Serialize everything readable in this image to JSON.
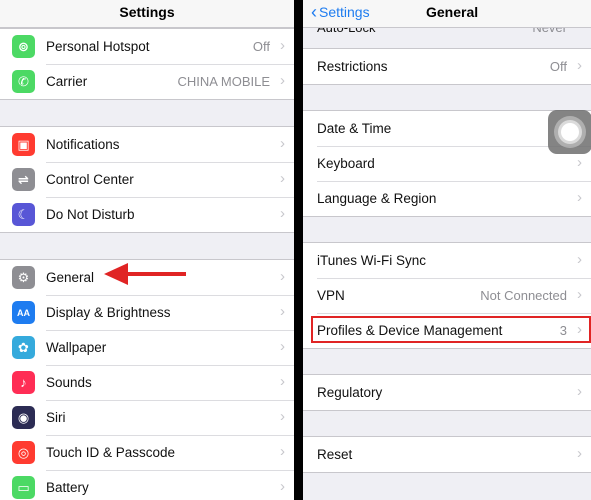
{
  "left": {
    "title": "Settings",
    "groups": [
      [
        {
          "label": "Personal Hotspot",
          "value": "Off",
          "icon": "hotspot-icon",
          "color": "#4cd964",
          "glyph": "⊚"
        },
        {
          "label": "Carrier",
          "value": "CHINA MOBILE",
          "icon": "phone-icon",
          "color": "#4cd964",
          "glyph": "✆"
        }
      ],
      [
        {
          "label": "Notifications",
          "value": "",
          "icon": "notifications-icon",
          "color": "#ff3b30",
          "glyph": "▣"
        },
        {
          "label": "Control Center",
          "value": "",
          "icon": "toggles-icon",
          "color": "#8e8e93",
          "glyph": "⇌"
        },
        {
          "label": "Do Not Disturb",
          "value": "",
          "icon": "moon-icon",
          "color": "#5856d6",
          "glyph": "☾"
        }
      ],
      [
        {
          "label": "General",
          "value": "",
          "icon": "gear-icon",
          "color": "#8e8e93",
          "glyph": "⚙"
        },
        {
          "label": "Display & Brightness",
          "value": "",
          "icon": "text-size-icon",
          "color": "#1e7cf0",
          "glyph": "AA"
        },
        {
          "label": "Wallpaper",
          "value": "",
          "icon": "flower-icon",
          "color": "#35aadc",
          "glyph": "✿"
        },
        {
          "label": "Sounds",
          "value": "",
          "icon": "speaker-icon",
          "color": "#ff2d55",
          "glyph": "♪"
        },
        {
          "label": "Siri",
          "value": "",
          "icon": "siri-icon",
          "color": "#2c2c54",
          "glyph": "◉"
        },
        {
          "label": "Touch ID & Passcode",
          "value": "",
          "icon": "fingerprint-icon",
          "color": "#ff3b30",
          "glyph": "◎"
        },
        {
          "label": "Battery",
          "value": "",
          "icon": "battery-icon",
          "color": "#4cd964",
          "glyph": "▭"
        }
      ]
    ]
  },
  "right": {
    "back_label": "Settings",
    "title": "General",
    "cutoff_label": "Auto-Lock",
    "cutoff_value": "Never",
    "groups": [
      [
        {
          "label": "Restrictions",
          "value": "Off"
        }
      ],
      [
        {
          "label": "Date & Time",
          "value": ""
        },
        {
          "label": "Keyboard",
          "value": ""
        },
        {
          "label": "Language & Region",
          "value": ""
        }
      ],
      [
        {
          "label": "iTunes Wi-Fi Sync",
          "value": ""
        },
        {
          "label": "VPN",
          "value": "Not Connected"
        },
        {
          "label": "Profiles & Device Management",
          "value": "3"
        }
      ],
      [
        {
          "label": "Regulatory",
          "value": ""
        }
      ],
      [
        {
          "label": "Reset",
          "value": ""
        }
      ]
    ]
  },
  "colors": {
    "accent": "#1e7cf0",
    "highlight": "#e02424",
    "arrow": "#e02424"
  }
}
